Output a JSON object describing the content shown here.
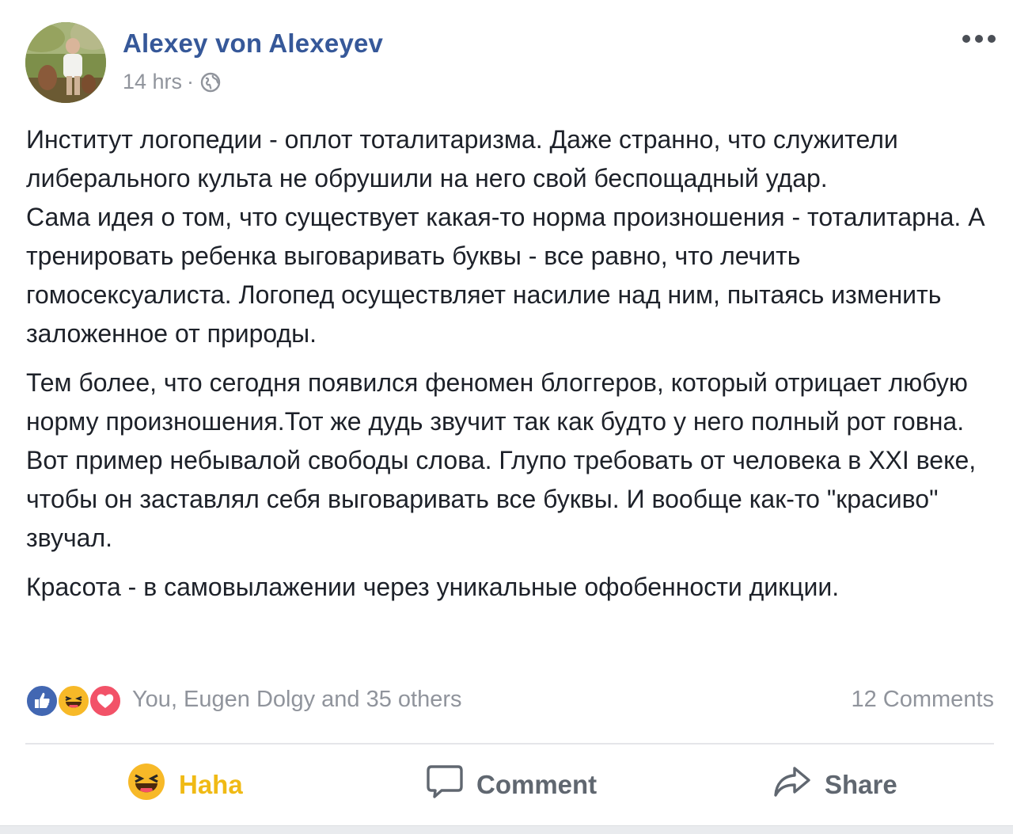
{
  "post": {
    "author": "Alexey von Alexeyev",
    "timestamp": "14 hrs",
    "separator": "·",
    "privacy_icon": "globe-icon",
    "menu_icon": "more-horizontal-icon",
    "paragraphs": [
      "Институт логопедии - оплот тоталитаризма. Даже странно, что служители либерального культа не обрушили на него свой беспощадный удар.\nСама идея о том, что существует какая-то норма произношения - тоталитарна. А тренировать ребенка выговаривать буквы - все равно, что лечить гомосексуалиста. Логопед осуществляет насилие над ним, пытаясь изменить заложенное от природы.",
      "Тем более, что сегодня появился феномен блоггеров, который отрицает любую норму произношения.Тот же дудь звучит так как будто у него полный рот говна. Вот пример небывалой свободы слова. Глупо требовать от человека в XXI веке, чтобы он заставлял себя выговаривать все буквы. И вообще как-то \"красиво\" звучал.",
      "Красота - в самовылажении через уникальные офобенности дикции."
    ]
  },
  "reactions": {
    "icons": [
      "like-icon",
      "haha-icon",
      "love-icon"
    ],
    "summary": "You, Eugen Dolgy and 35 others",
    "comments": "12 Comments"
  },
  "actions": {
    "haha_label": "Haha",
    "comment_label": "Comment",
    "share_label": "Share"
  },
  "colors": {
    "author_link": "#365899",
    "meta_gray": "#90949c",
    "text": "#1d2129",
    "haha_active": "#f0ba15",
    "like_blue": "#4267b2",
    "love_red": "#f25268"
  }
}
